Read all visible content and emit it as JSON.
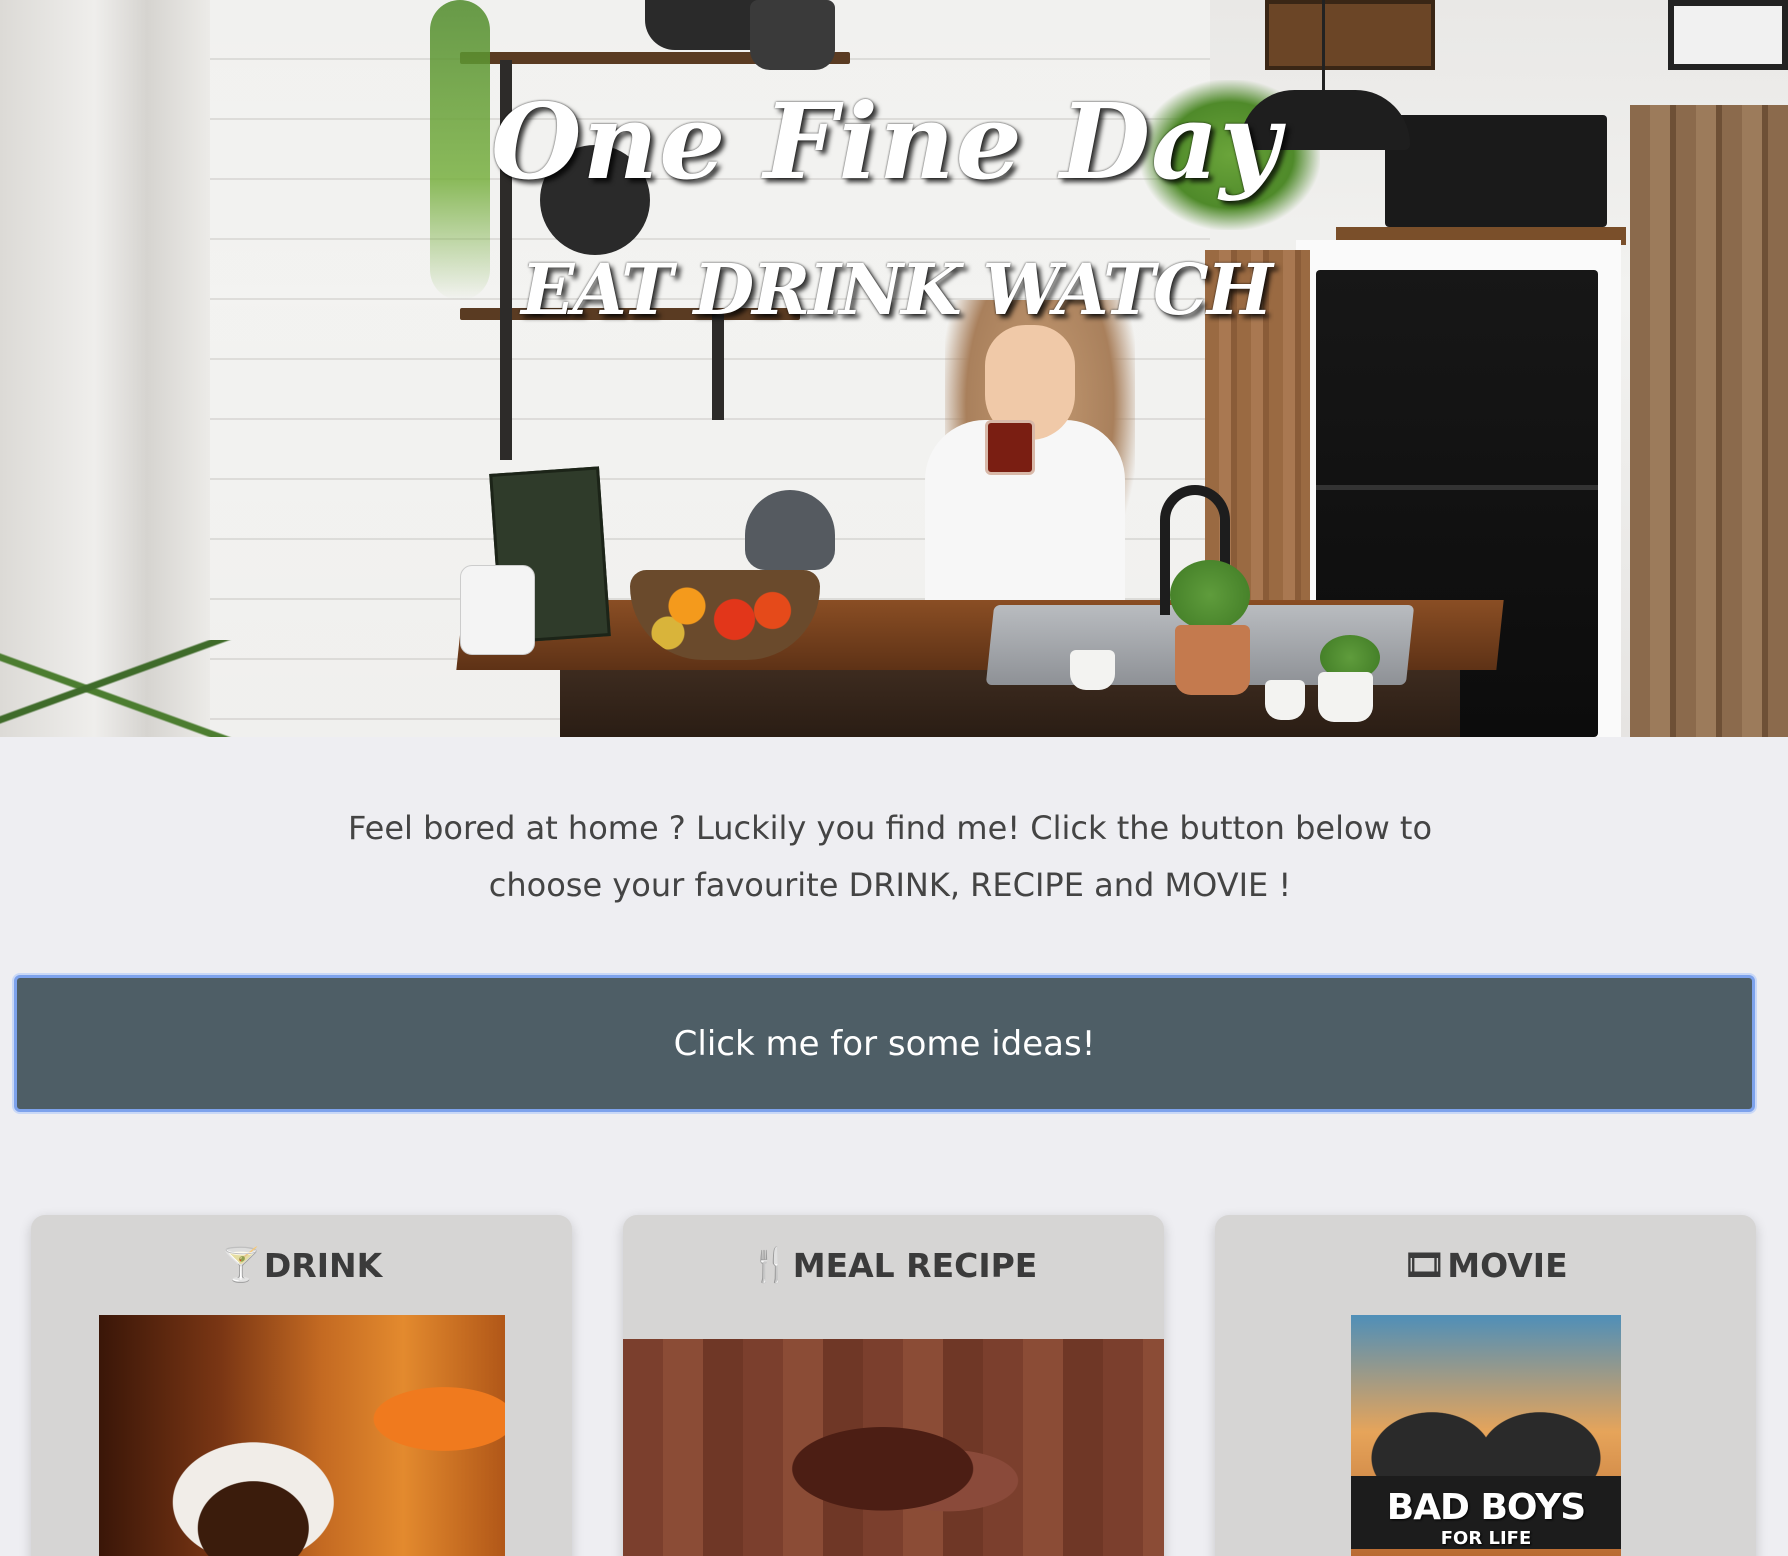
{
  "hero": {
    "title": "One Fine Day",
    "subtitle": "EAT DRINK WATCH"
  },
  "intro": {
    "line1": "Feel bored at home ? Luckily you find me! Click the button below to",
    "line2": "choose your favourite DRINK, RECIPE and MOVIE !"
  },
  "cta": {
    "label": "Click me for some ideas!"
  },
  "cards": [
    {
      "icon": "cocktail-icon",
      "icon_glyph": "🍸",
      "title": "DRINK"
    },
    {
      "icon": "utensils-icon",
      "icon_glyph": "🍴",
      "title": "MEAL RECIPE"
    },
    {
      "icon": "film-icon",
      "icon_glyph": "🎞",
      "title": "MOVIE"
    }
  ],
  "movie_poster": {
    "title": "BAD BOYS",
    "tagline": "FOR LIFE"
  },
  "colors": {
    "background": "#eeeef2",
    "button": "#4e5e66",
    "button_focus_ring": "#7da2ec",
    "card": "#d6d5d4"
  }
}
